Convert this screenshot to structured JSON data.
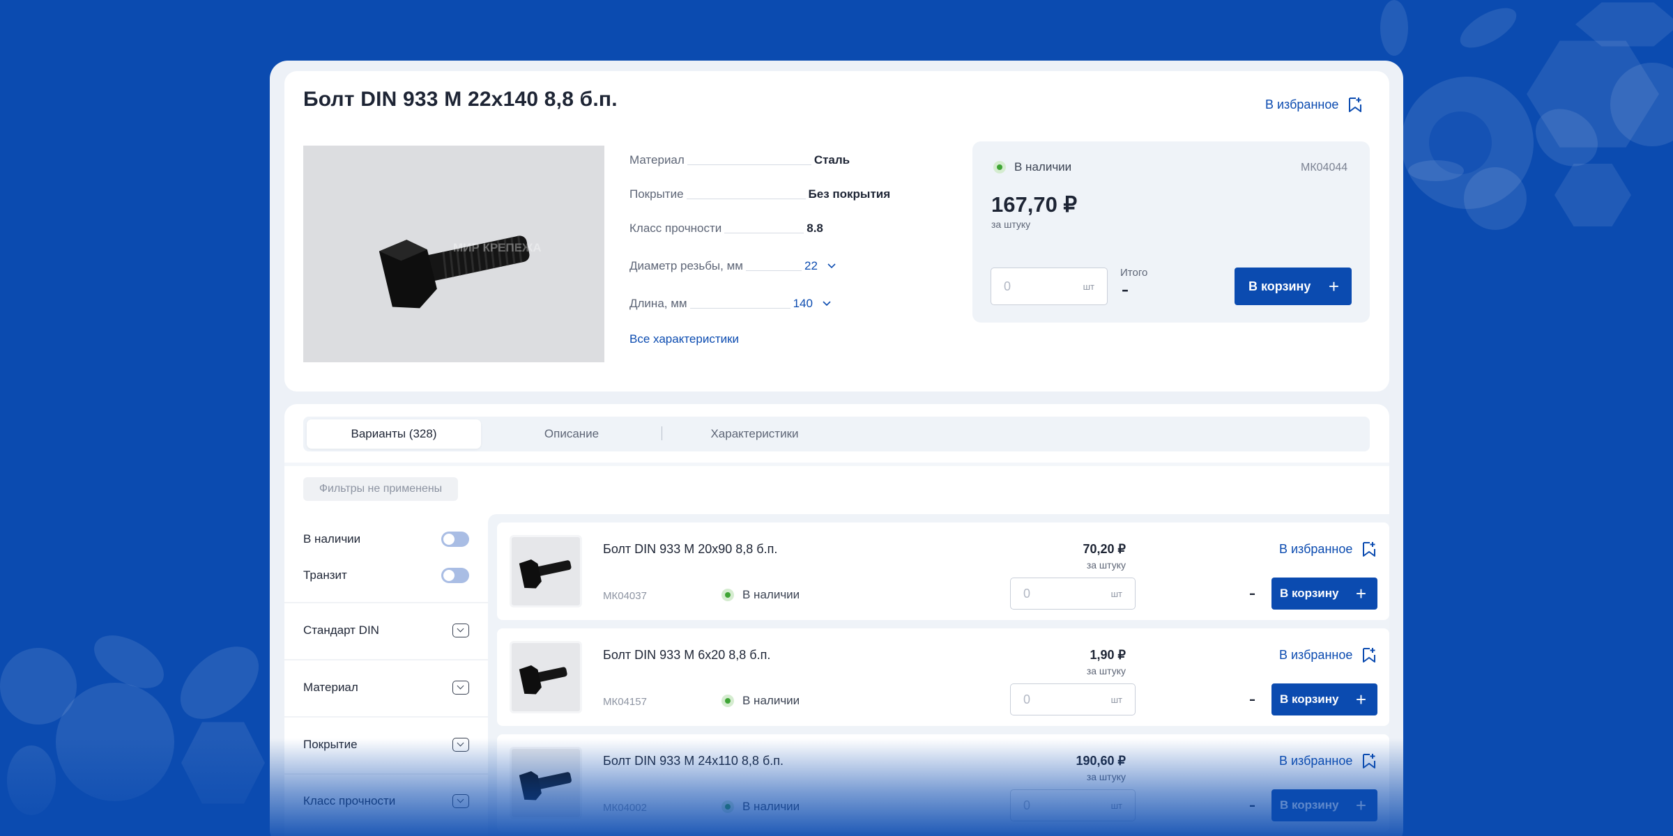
{
  "product": {
    "title": "Болт DIN 933 М 22х140 8,8 б.п.",
    "favorite_label": "В избранное",
    "image_watermark": "МИР КРЕПЕЖА",
    "specs": [
      {
        "label": "Материал",
        "value": "Сталь"
      },
      {
        "label": "Покрытие",
        "value": "Без покрытия"
      },
      {
        "label": "Класс прочности",
        "value": "8.8"
      },
      {
        "label": "Диаметр резьбы, мм",
        "value": "22"
      },
      {
        "label": "Длина, мм",
        "value": "140"
      }
    ],
    "all_specs_link": "Все характеристики"
  },
  "buy": {
    "availability": "В наличии",
    "sku": "МК04044",
    "price": "167,70 ₽",
    "per_unit": "за штуку",
    "qty_value": "0",
    "qty_unit": "шт",
    "total_label": "Итого",
    "total_value": "–",
    "cart_label": "В корзину"
  },
  "tabs": [
    {
      "label": "Варианты (328)",
      "active": true
    },
    {
      "label": "Описание",
      "active": false
    },
    {
      "label": "Характеристики",
      "active": false
    }
  ],
  "filters": {
    "chip": "Фильтры не применены",
    "toggles": [
      {
        "label": "В наличии",
        "on": false
      },
      {
        "label": "Транзит",
        "on": false
      }
    ],
    "facets": [
      "Стандарт DIN",
      "Материал",
      "Покрытие",
      "Класс прочности"
    ]
  },
  "variants": [
    {
      "name": "Болт DIN 933 М 20х90 8,8 б.п.",
      "sku": "МК04037",
      "availability": "В наличии",
      "price": "70,20 ₽",
      "per_unit": "за штуку",
      "qty_value": "0",
      "qty_unit": "шт",
      "total": "–",
      "favorite_label": "В избранное",
      "cart_label": "В корзину"
    },
    {
      "name": "Болт DIN 933 М 6х20 8,8 б.п.",
      "sku": "МК04157",
      "availability": "В наличии",
      "price": "1,90 ₽",
      "per_unit": "за штуку",
      "qty_value": "0",
      "qty_unit": "шт",
      "total": "–",
      "favorite_label": "В избранное",
      "cart_label": "В корзину"
    },
    {
      "name": "Болт DIN 933 М 24х110 8,8 б.п.",
      "sku": "МК04002",
      "availability": "В наличии",
      "price": "190,60 ₽",
      "per_unit": "за штуку",
      "qty_value": "0",
      "qty_unit": "шт",
      "total": "–",
      "favorite_label": "В избранное",
      "cart_label": "В корзину"
    }
  ],
  "colors": {
    "brand": "#0b4bb0",
    "background": "#0b4bb0",
    "in_stock": "#3fa535",
    "toggle_off": "#a9bde4"
  },
  "icons": [
    "bookmark-plus-icon",
    "chevron-down-icon",
    "plus-icon",
    "status-dot-icon",
    "dropdown-box-icon"
  ]
}
